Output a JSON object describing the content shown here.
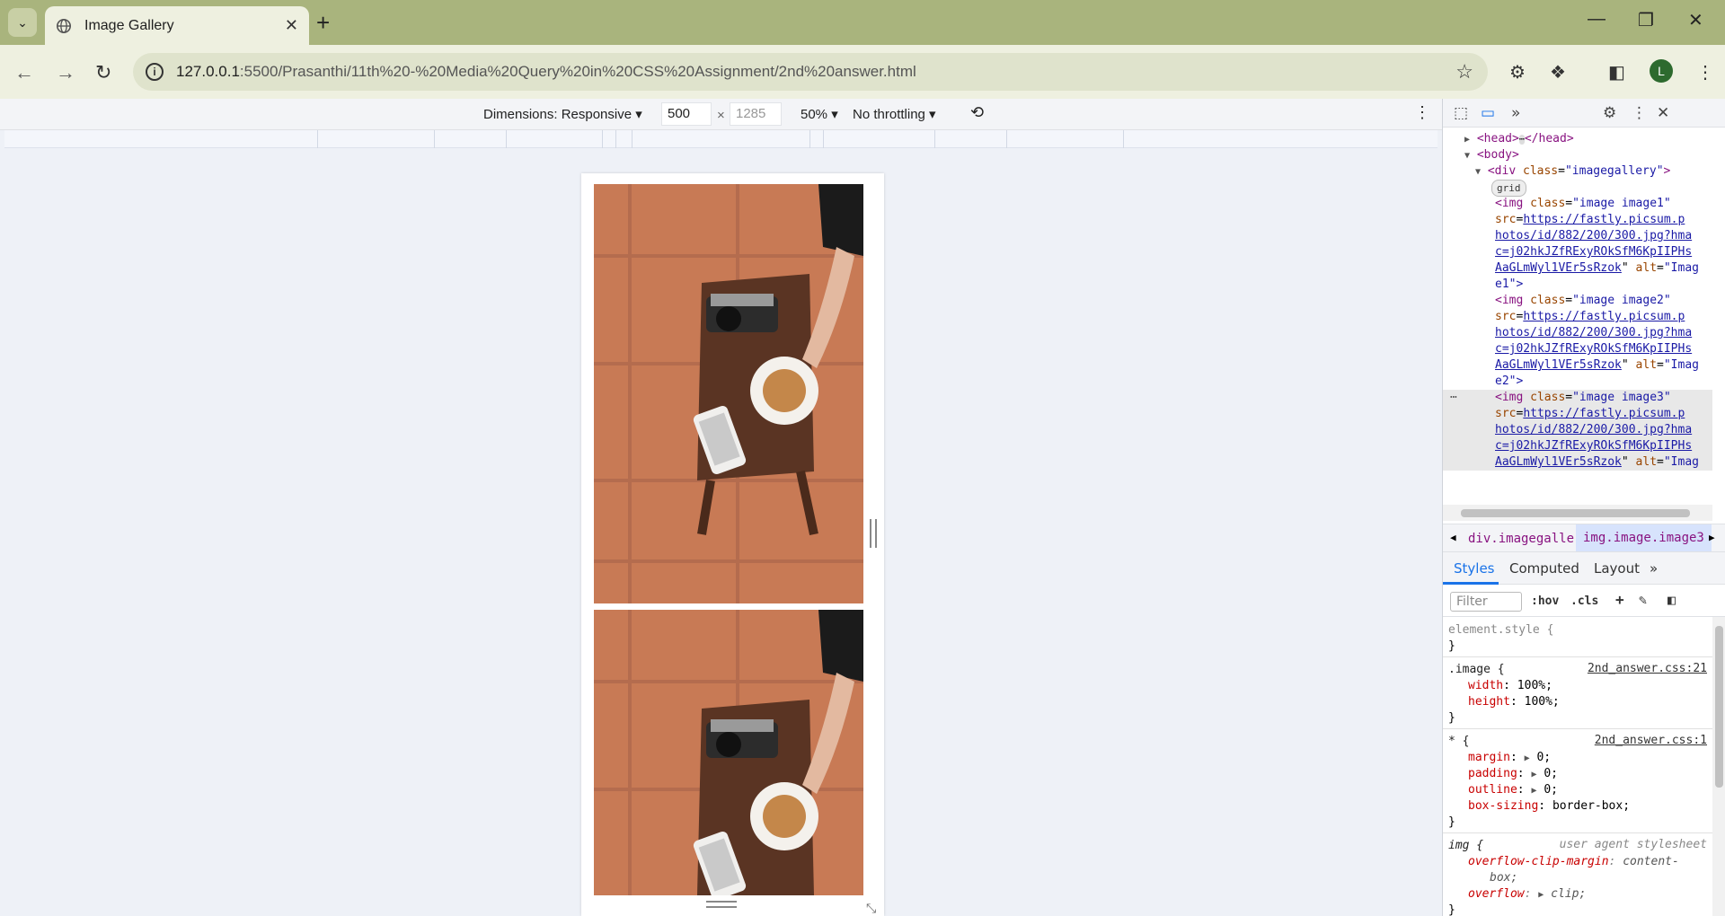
{
  "browser": {
    "tab_title": "Image Gallery",
    "url_host": "127.0.0.1",
    "url_rest": ":5500/Prasanthi/11th%20-%20Media%20Query%20in%20CSS%20Assignment/2nd%20answer.html",
    "profile_initial": "L"
  },
  "device_toolbar": {
    "dimensions_label": "Dimensions: Responsive",
    "width_value": "500",
    "times": "×",
    "height_placeholder": "1285",
    "zoom": "50%",
    "throttling": "No throttling"
  },
  "dom": {
    "head_open": "<head>",
    "head_close": "</head>",
    "body": "<body>",
    "div_open": "<div",
    "div_class_attr": "class",
    "div_class_val": "\"imagegallery\"",
    "div_end": ">",
    "grid_badge": "grid",
    "images": [
      {
        "open": "<img",
        "class_val": "\"image image1\"",
        "src_lines": [
          "https://fastly.picsum.p",
          "hotos/id/882/200/300.jpg?hma",
          "c=j02hkJZfRExyROkSfM6KpIIPHs",
          "AaGLmWyl1VEr5sRzok"
        ],
        "alt_val": "\"Imag",
        "alt_cont": "e1\">"
      },
      {
        "open": "<img",
        "class_val": "\"image image2\"",
        "src_lines": [
          "https://fastly.picsum.p",
          "hotos/id/882/200/300.jpg?hma",
          "c=j02hkJZfRExyROkSfM6KpIIPHs",
          "AaGLmWyl1VEr5sRzok"
        ],
        "alt_val": "\"Imag",
        "alt_cont": "e2\">"
      },
      {
        "open": "<img",
        "class_val": "\"image image3\"",
        "src_lines": [
          "https://fastly.picsum.p",
          "hotos/id/882/200/300.jpg?hma",
          "c=j02hkJZfRExyROkSfM6KpIIPHs",
          "AaGLmWyl1VEr5sRzok"
        ],
        "alt_val": "\"Imag",
        "alt_cont": ""
      }
    ]
  },
  "breadcrumbs": {
    "item1": "div.imagegallery",
    "item2": "img.image.image3"
  },
  "styles_tabs": {
    "styles": "Styles",
    "computed": "Computed",
    "layout": "Layout"
  },
  "filter": {
    "placeholder": "Filter",
    "hov": ":hov",
    "cls": ".cls"
  },
  "rules": {
    "element_style": "element.style {",
    "close": "}",
    "image_selector": ".image {",
    "image_source": "2nd_answer.css:21",
    "image_props": [
      {
        "name": "width",
        "value": "100%;"
      },
      {
        "name": "height",
        "value": "100%;"
      }
    ],
    "star_selector": "* {",
    "star_source": "2nd_answer.css:1",
    "star_props": [
      {
        "name": "margin",
        "value": "0;"
      },
      {
        "name": "padding",
        "value": "0;"
      },
      {
        "name": "outline",
        "value": "0;"
      },
      {
        "name": "box-sizing",
        "value": "border-box;"
      }
    ],
    "img_selector": "img {",
    "img_source": "user agent stylesheet",
    "img_props": [
      {
        "name": "overflow-clip-margin",
        "value": "content-"
      },
      {
        "name": "",
        "value": "box;"
      },
      {
        "name": "overflow",
        "value": "clip;"
      }
    ]
  },
  "colors": {
    "title_bar": "#a9b47d",
    "toolbar": "#eef0e0",
    "viewport_bg": "#eef1f7",
    "accent": "#1a73e8"
  }
}
